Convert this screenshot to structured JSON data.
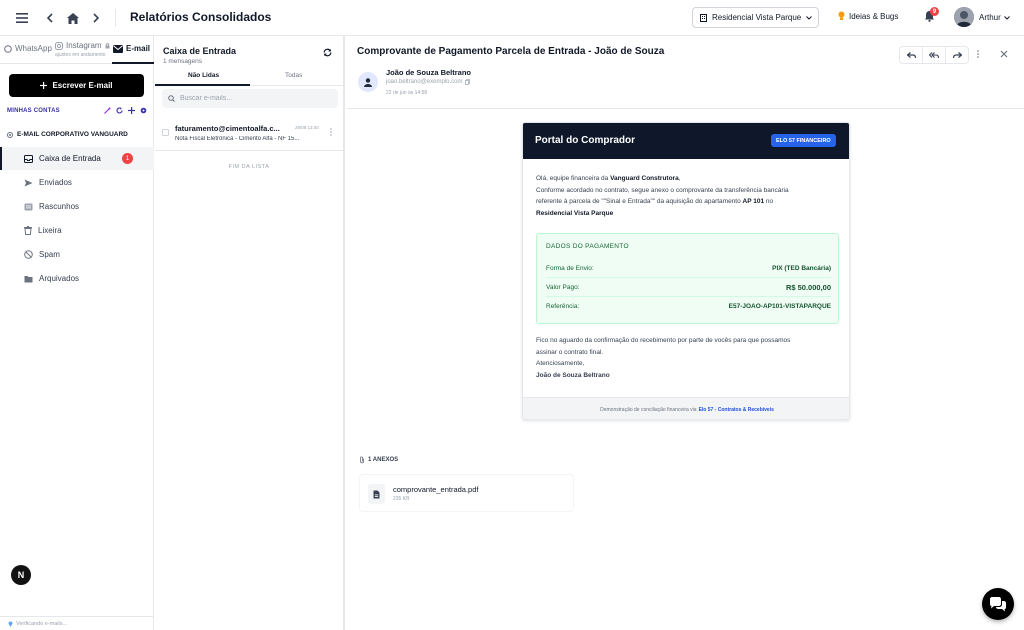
{
  "topbar": {
    "title": "Relatórios Consolidados",
    "property_select": "Residencial Vista Parque",
    "ideas_label": "Ideias & Bugs",
    "notifications_count": "9",
    "user_name": "Arthur"
  },
  "sidebar": {
    "tabs": [
      {
        "label": "WhatsApp"
      },
      {
        "label": "Instagram",
        "sub": "ajustes em andamento"
      },
      {
        "label": "E-mail"
      }
    ],
    "compose_label": "Escrever E-mail",
    "accounts_label": "MINHAS CONTAS",
    "account_group": "E-MAIL CORPORATIVO VANGUARD",
    "folders": [
      {
        "label": "Caixa de Entrada",
        "count": "1"
      },
      {
        "label": "Enviados"
      },
      {
        "label": "Rascunhos"
      },
      {
        "label": "Lixeira"
      },
      {
        "label": "Spam"
      },
      {
        "label": "Arquivados"
      }
    ],
    "footer_status": "Verificando e-mails...",
    "logo_letter": "N"
  },
  "message_list": {
    "title": "Caixa de Entrada",
    "count_text": "1 mensagens",
    "tabs": [
      "Não Lidas",
      "Todas"
    ],
    "search_placeholder": "Buscar e-mails...",
    "items": [
      {
        "from": "faturamento@cimentoalfa.c...",
        "date": "28/08 13:40",
        "subject": "Nota Fiscal Eletrônica - Cimento Alfa - NF 15..."
      }
    ],
    "end_label": "FIM DA LISTA"
  },
  "reader": {
    "subject": "Comprovante de Pagamento Parcela de Entrada - João de Souza",
    "sender_name": "João de Souza Beltrano",
    "sender_email": "joao.beltrano@exemplo.com",
    "date": "22 de jun às 14:58",
    "card": {
      "header_title": "Portal do Comprador",
      "badge": "ELO 57 FINANCEIRO",
      "greeting_prefix": "Olá, equipe financeira da ",
      "greeting_company": "Vanguard Construtora",
      "greeting_suffix": ",",
      "body_line1": "Conforme acordado no contrato, segue anexo o comprovante da transferência bancária",
      "body_line2_prefix": "referente à parcela de \"\"Sinal e Entrada\"\" da aquisição do apartamento ",
      "body_apto": "AP 101",
      "body_line2_suffix": " no",
      "body_project": "Residencial Vista Parque",
      "payment_title": "DADOS DO PAGAMENTO",
      "payment_rows": [
        {
          "label": "Forma de Envio:",
          "value": "PIX (TED Bancária)"
        },
        {
          "label": "Valor Pago:",
          "value": "R$ 50.000,00"
        },
        {
          "label": "Referência:",
          "value": "E57-JOAO-AP101-VISTAPARQUE"
        }
      ],
      "closing_line1": "Fico no aguardo da confirmação do recebimento por parte de vocês para que possamos",
      "closing_line2": "assinar o contrato final.",
      "closing_line3": "Atenciosamente,",
      "signature": "João de Souza Beltrano",
      "footer_text": "Demonstração de conciliação financeira via",
      "footer_link": "Elo 57 - Contratos & Recebíveis"
    },
    "attachments_label": "1 ANEXOS",
    "attachments": [
      {
        "name": "comprovante_entrada.pdf",
        "size": "235 KB"
      }
    ]
  },
  "colors": {
    "accent": "#3730a3",
    "card_header": "#0f172a",
    "badge": "#2563eb",
    "payment_bg": "#f0fdf4",
    "unread_badge": "#ef4444"
  }
}
